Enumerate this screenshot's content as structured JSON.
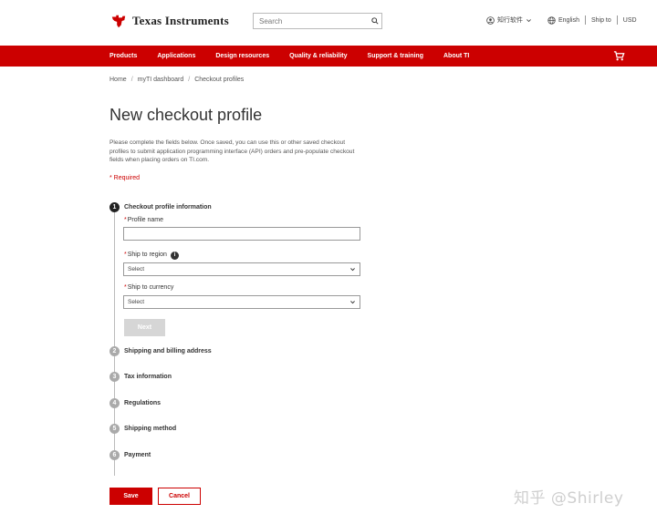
{
  "header": {
    "brand": "Texas Instruments",
    "search_placeholder": "Search",
    "account_label": "知行软件",
    "language": "English",
    "ship_to": "Ship to",
    "currency": "USD"
  },
  "nav": {
    "items": [
      {
        "label": "Products"
      },
      {
        "label": "Applications"
      },
      {
        "label": "Design resources"
      },
      {
        "label": "Quality & reliability"
      },
      {
        "label": "Support & training"
      },
      {
        "label": "About TI"
      }
    ]
  },
  "breadcrumb": [
    "Home",
    "myTI dashboard",
    "Checkout profiles"
  ],
  "page": {
    "title": "New checkout profile",
    "intro": "Please complete the fields below. Once saved, you can use this or other saved checkout profiles to submit application programming interface (API) orders and pre-populate checkout fields when placing orders on TI.com.",
    "required_note": "* Required"
  },
  "steps": [
    {
      "number": "1",
      "label": "Checkout profile information",
      "active": true
    },
    {
      "number": "2",
      "label": "Shipping and billing address",
      "active": false
    },
    {
      "number": "3",
      "label": "Tax information",
      "active": false
    },
    {
      "number": "4",
      "label": "Regulations",
      "active": false
    },
    {
      "number": "5",
      "label": "Shipping method",
      "active": false
    },
    {
      "number": "6",
      "label": "Payment",
      "active": false
    }
  ],
  "form": {
    "profile_name_label": "Profile name",
    "profile_name_value": "",
    "ship_region_label": "Ship to region",
    "ship_region_value": "Select",
    "ship_currency_label": "Ship to currency",
    "ship_currency_value": "Select",
    "info_icon": "i",
    "required_star": "*",
    "next_label": "Next"
  },
  "actions": {
    "save_label": "Save",
    "cancel_label": "Cancel"
  },
  "watermark": "知乎 @Shirley",
  "colors": {
    "brand_red": "#cc0000",
    "step_active": "#222222",
    "step_inactive": "#aaaaaa"
  }
}
